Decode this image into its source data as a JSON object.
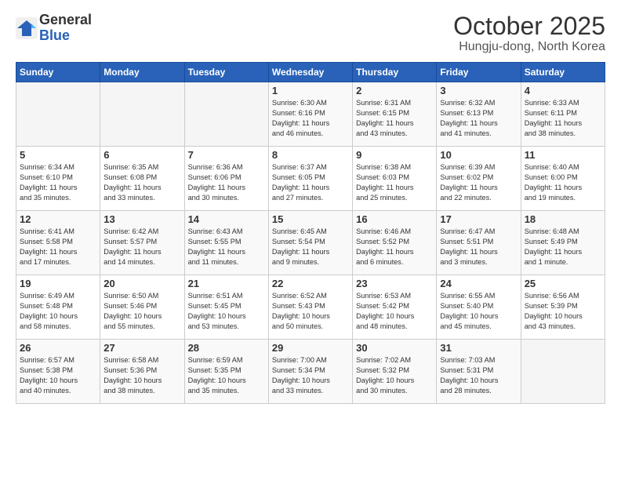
{
  "header": {
    "logo_general": "General",
    "logo_blue": "Blue",
    "month_title": "October 2025",
    "subtitle": "Hungju-dong, North Korea"
  },
  "days_of_week": [
    "Sunday",
    "Monday",
    "Tuesday",
    "Wednesday",
    "Thursday",
    "Friday",
    "Saturday"
  ],
  "weeks": [
    [
      {
        "day": "",
        "info": ""
      },
      {
        "day": "",
        "info": ""
      },
      {
        "day": "",
        "info": ""
      },
      {
        "day": "1",
        "info": "Sunrise: 6:30 AM\nSunset: 6:16 PM\nDaylight: 11 hours\nand 46 minutes."
      },
      {
        "day": "2",
        "info": "Sunrise: 6:31 AM\nSunset: 6:15 PM\nDaylight: 11 hours\nand 43 minutes."
      },
      {
        "day": "3",
        "info": "Sunrise: 6:32 AM\nSunset: 6:13 PM\nDaylight: 11 hours\nand 41 minutes."
      },
      {
        "day": "4",
        "info": "Sunrise: 6:33 AM\nSunset: 6:11 PM\nDaylight: 11 hours\nand 38 minutes."
      }
    ],
    [
      {
        "day": "5",
        "info": "Sunrise: 6:34 AM\nSunset: 6:10 PM\nDaylight: 11 hours\nand 35 minutes."
      },
      {
        "day": "6",
        "info": "Sunrise: 6:35 AM\nSunset: 6:08 PM\nDaylight: 11 hours\nand 33 minutes."
      },
      {
        "day": "7",
        "info": "Sunrise: 6:36 AM\nSunset: 6:06 PM\nDaylight: 11 hours\nand 30 minutes."
      },
      {
        "day": "8",
        "info": "Sunrise: 6:37 AM\nSunset: 6:05 PM\nDaylight: 11 hours\nand 27 minutes."
      },
      {
        "day": "9",
        "info": "Sunrise: 6:38 AM\nSunset: 6:03 PM\nDaylight: 11 hours\nand 25 minutes."
      },
      {
        "day": "10",
        "info": "Sunrise: 6:39 AM\nSunset: 6:02 PM\nDaylight: 11 hours\nand 22 minutes."
      },
      {
        "day": "11",
        "info": "Sunrise: 6:40 AM\nSunset: 6:00 PM\nDaylight: 11 hours\nand 19 minutes."
      }
    ],
    [
      {
        "day": "12",
        "info": "Sunrise: 6:41 AM\nSunset: 5:58 PM\nDaylight: 11 hours\nand 17 minutes."
      },
      {
        "day": "13",
        "info": "Sunrise: 6:42 AM\nSunset: 5:57 PM\nDaylight: 11 hours\nand 14 minutes."
      },
      {
        "day": "14",
        "info": "Sunrise: 6:43 AM\nSunset: 5:55 PM\nDaylight: 11 hours\nand 11 minutes."
      },
      {
        "day": "15",
        "info": "Sunrise: 6:45 AM\nSunset: 5:54 PM\nDaylight: 11 hours\nand 9 minutes."
      },
      {
        "day": "16",
        "info": "Sunrise: 6:46 AM\nSunset: 5:52 PM\nDaylight: 11 hours\nand 6 minutes."
      },
      {
        "day": "17",
        "info": "Sunrise: 6:47 AM\nSunset: 5:51 PM\nDaylight: 11 hours\nand 3 minutes."
      },
      {
        "day": "18",
        "info": "Sunrise: 6:48 AM\nSunset: 5:49 PM\nDaylight: 11 hours\nand 1 minute."
      }
    ],
    [
      {
        "day": "19",
        "info": "Sunrise: 6:49 AM\nSunset: 5:48 PM\nDaylight: 10 hours\nand 58 minutes."
      },
      {
        "day": "20",
        "info": "Sunrise: 6:50 AM\nSunset: 5:46 PM\nDaylight: 10 hours\nand 55 minutes."
      },
      {
        "day": "21",
        "info": "Sunrise: 6:51 AM\nSunset: 5:45 PM\nDaylight: 10 hours\nand 53 minutes."
      },
      {
        "day": "22",
        "info": "Sunrise: 6:52 AM\nSunset: 5:43 PM\nDaylight: 10 hours\nand 50 minutes."
      },
      {
        "day": "23",
        "info": "Sunrise: 6:53 AM\nSunset: 5:42 PM\nDaylight: 10 hours\nand 48 minutes."
      },
      {
        "day": "24",
        "info": "Sunrise: 6:55 AM\nSunset: 5:40 PM\nDaylight: 10 hours\nand 45 minutes."
      },
      {
        "day": "25",
        "info": "Sunrise: 6:56 AM\nSunset: 5:39 PM\nDaylight: 10 hours\nand 43 minutes."
      }
    ],
    [
      {
        "day": "26",
        "info": "Sunrise: 6:57 AM\nSunset: 5:38 PM\nDaylight: 10 hours\nand 40 minutes."
      },
      {
        "day": "27",
        "info": "Sunrise: 6:58 AM\nSunset: 5:36 PM\nDaylight: 10 hours\nand 38 minutes."
      },
      {
        "day": "28",
        "info": "Sunrise: 6:59 AM\nSunset: 5:35 PM\nDaylight: 10 hours\nand 35 minutes."
      },
      {
        "day": "29",
        "info": "Sunrise: 7:00 AM\nSunset: 5:34 PM\nDaylight: 10 hours\nand 33 minutes."
      },
      {
        "day": "30",
        "info": "Sunrise: 7:02 AM\nSunset: 5:32 PM\nDaylight: 10 hours\nand 30 minutes."
      },
      {
        "day": "31",
        "info": "Sunrise: 7:03 AM\nSunset: 5:31 PM\nDaylight: 10 hours\nand 28 minutes."
      },
      {
        "day": "",
        "info": ""
      }
    ]
  ]
}
